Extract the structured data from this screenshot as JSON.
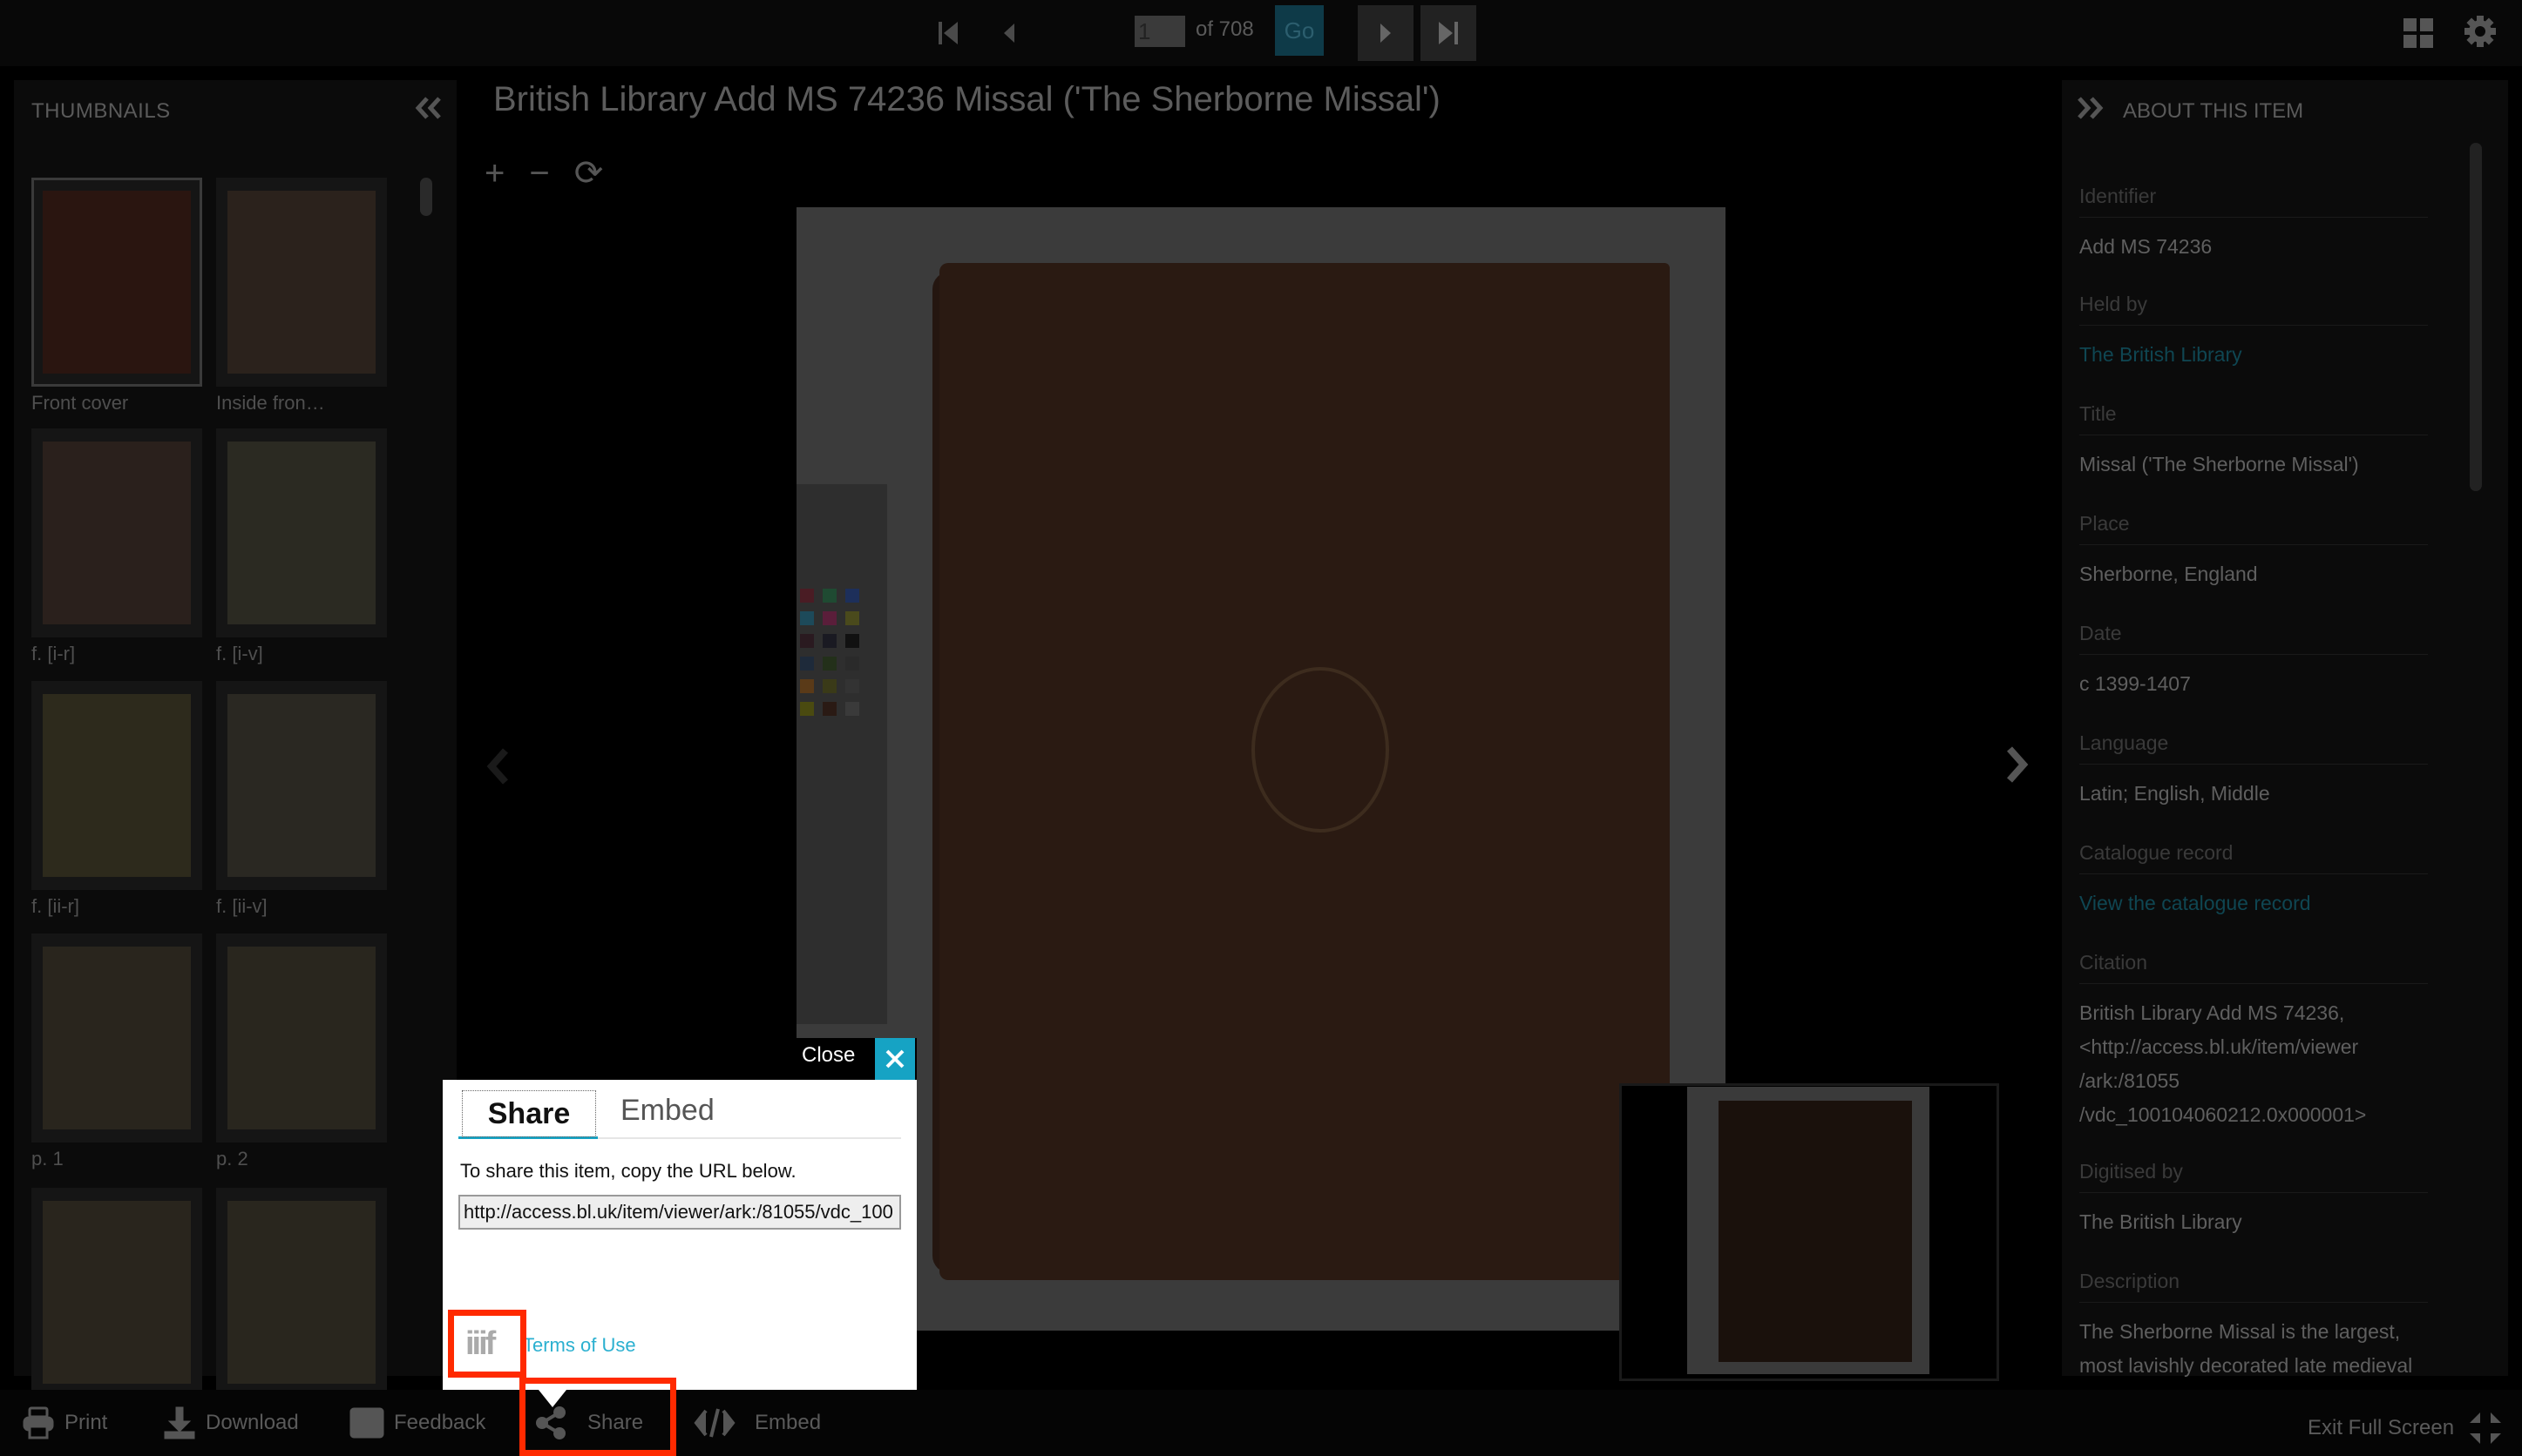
{
  "topbar": {
    "page_value": "1",
    "page_of": "of 708",
    "go_label": "Go",
    "icons": [
      "first-page-icon",
      "prev-page-icon",
      "next-page-icon",
      "last-page-icon",
      "grid-view-icon",
      "settings-gear-icon"
    ]
  },
  "thumbnails": {
    "title": "THUMBNAILS",
    "items": [
      {
        "label": "Front cover",
        "selected": true,
        "color": "#2a1510"
      },
      {
        "label": "Inside fron…",
        "selected": false,
        "color": "#2b221c"
      },
      {
        "label": "f. [i-r]",
        "selected": false,
        "color": "#2a201c"
      },
      {
        "label": "f. [i-v]",
        "selected": false,
        "color": "#2b2a22"
      },
      {
        "label": "f. [ii-r]",
        "selected": false,
        "color": "#2d2a1c"
      },
      {
        "label": "f. [ii-v]",
        "selected": false,
        "color": "#2a2822"
      },
      {
        "label": "p. 1",
        "selected": false,
        "color": "#29251d"
      },
      {
        "label": "p. 2",
        "selected": false,
        "color": "#29261e"
      },
      {
        "label": "",
        "selected": false,
        "color": "#29251d"
      },
      {
        "label": "",
        "selected": false,
        "color": "#29261e"
      }
    ]
  },
  "main": {
    "title": "British Library Add MS 74236 Missal ('The Sherborne Missal')",
    "zoom_in": "+",
    "zoom_out": "−",
    "rotate": "⟳"
  },
  "about": {
    "title": "ABOUT THIS ITEM",
    "fields": [
      {
        "key": "Identifier",
        "value": "Add MS 74236",
        "link": false
      },
      {
        "key": "Held by",
        "value": "The British Library",
        "link": true
      },
      {
        "key": "Title",
        "value": "Missal ('The Sherborne Missal')",
        "link": false
      },
      {
        "key": "Place",
        "value": "Sherborne, England",
        "link": false
      },
      {
        "key": "Date",
        "value": "c 1399-1407",
        "link": false
      },
      {
        "key": "Language",
        "value": "Latin; English, Middle",
        "link": false
      },
      {
        "key": "Catalogue record",
        "value": "View the catalogue record",
        "link": true
      },
      {
        "key": "Citation",
        "value": "British Library Add MS 74236, <http://access.bl.uk/item/viewer /ark:/81055 /vdc_100104060212.0x000001>",
        "link": false
      },
      {
        "key": "Digitised by",
        "value": "The British Library",
        "link": false
      },
      {
        "key": "Description",
        "value": "The Sherborne Missal is the largest, most lavishly decorated late medieval",
        "link": false
      }
    ]
  },
  "dialog": {
    "close_label": "Close",
    "tabs": [
      "Share",
      "Embed"
    ],
    "active_tab": "Share",
    "instruction": "To share this item, copy the URL below.",
    "url_value": "http://access.bl.uk/item/viewer/ark:/81055/vdc_100",
    "iiif_label": "iiif",
    "terms_label": "Terms of Use"
  },
  "bottombar": {
    "print": "Print",
    "download": "Download",
    "feedback": "Feedback",
    "share": "Share",
    "embed": "Embed",
    "exit_fullscreen": "Exit Full Screen"
  },
  "colors": {
    "accent": "#16a3c4",
    "highlight": "#ff2a00",
    "link": "#2bb0d0"
  }
}
